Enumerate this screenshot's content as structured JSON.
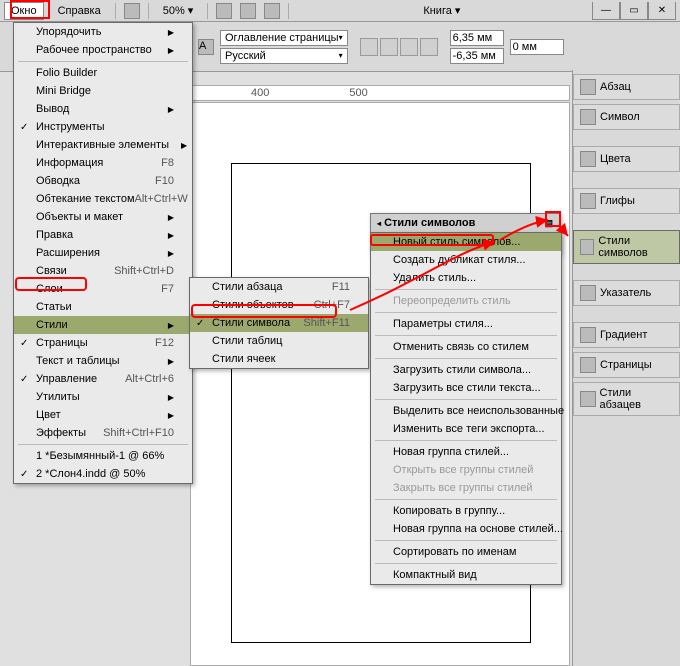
{
  "menubar": {
    "okno": "Окно",
    "spravka": "Справка",
    "zoom": "50%",
    "kniga": "Книга"
  },
  "toolbar": {
    "oglavlenie": "Оглавление страницы",
    "lang": "Русский",
    "val_top": "6,35 мм",
    "val_bottom": "-6,35 мм",
    "val_right": "0 мм"
  },
  "ruler": {
    "t1": "400",
    "t2": "500"
  },
  "window_menu": {
    "items": [
      {
        "label": "Упорядочить",
        "submenu": true
      },
      {
        "label": "Рабочее пространство",
        "submenu": true
      },
      {
        "div": true
      },
      {
        "label": "Folio Builder"
      },
      {
        "label": "Mini Bridge"
      },
      {
        "label": "Вывод",
        "submenu": true
      },
      {
        "label": "Инструменты",
        "check": true
      },
      {
        "label": "Интерактивные элементы",
        "submenu": true
      },
      {
        "label": "Информация",
        "sc": "F8"
      },
      {
        "label": "Обводка",
        "sc": "F10"
      },
      {
        "label": "Обтекание текстом",
        "sc": "Alt+Ctrl+W"
      },
      {
        "label": "Объекты и макет",
        "submenu": true
      },
      {
        "label": "Правка",
        "submenu": true
      },
      {
        "label": "Расширения",
        "submenu": true
      },
      {
        "label": "Связи",
        "sc": "Shift+Ctrl+D"
      },
      {
        "label": "Слои",
        "sc": "F7"
      },
      {
        "label": "Статьи"
      },
      {
        "label": "Стили",
        "submenu": true,
        "hl": true
      },
      {
        "label": "Страницы",
        "sc": "F12",
        "check": true
      },
      {
        "label": "Текст и таблицы",
        "submenu": true
      },
      {
        "label": "Управление",
        "sc": "Alt+Ctrl+6",
        "check": true
      },
      {
        "label": "Утилиты",
        "submenu": true
      },
      {
        "label": "Цвет",
        "submenu": true
      },
      {
        "label": "Эффекты",
        "sc": "Shift+Ctrl+F10"
      },
      {
        "div": true
      },
      {
        "label": "1 *Безымянный-1 @ 66%"
      },
      {
        "label": "2 *Слон4.indd @ 50%",
        "check": true
      }
    ]
  },
  "styles_submenu": {
    "items": [
      {
        "label": "Стили абзаца",
        "sc": "F11"
      },
      {
        "label": "Стили объектов",
        "sc": "Ctrl+F7"
      },
      {
        "label": "Стили символа",
        "sc": "Shift+F11",
        "hl": true,
        "check": true
      },
      {
        "label": "Стили таблиц"
      },
      {
        "label": "Стили ячеек"
      }
    ]
  },
  "flyout": {
    "title": "Стили символов"
  },
  "flyout_menu": {
    "items": [
      {
        "label": "Новый стиль символов...",
        "hl": true
      },
      {
        "label": "Создать дубликат стиля..."
      },
      {
        "label": "Удалить стиль..."
      },
      {
        "div": true
      },
      {
        "label": "Переопределить стиль",
        "dis": true
      },
      {
        "div": true
      },
      {
        "label": "Параметры стиля..."
      },
      {
        "div": true
      },
      {
        "label": "Отменить связь со стилем"
      },
      {
        "div": true
      },
      {
        "label": "Загрузить стили символа..."
      },
      {
        "label": "Загрузить все стили текста..."
      },
      {
        "div": true
      },
      {
        "label": "Выделить все неиспользованные"
      },
      {
        "label": "Изменить все теги экспорта..."
      },
      {
        "div": true
      },
      {
        "label": "Новая группа стилей..."
      },
      {
        "label": "Открыть все группы стилей",
        "dis": true
      },
      {
        "label": "Закрыть все группы стилей",
        "dis": true
      },
      {
        "div": true
      },
      {
        "label": "Копировать в группу..."
      },
      {
        "label": "Новая группа на основе стилей..."
      },
      {
        "div": true
      },
      {
        "label": "Сортировать по именам"
      },
      {
        "div": true
      },
      {
        "label": "Компактный вид"
      }
    ]
  },
  "dock": {
    "abzac": "Абзац",
    "simvol": "Символ",
    "cveta": "Цвета",
    "glify": "Глифы",
    "stili_simvolov": "Стили символов",
    "ukazatel": "Указатель",
    "gradient": "Градиент",
    "stranicy": "Страницы",
    "stili_abzacev": "Стили абзацев"
  }
}
